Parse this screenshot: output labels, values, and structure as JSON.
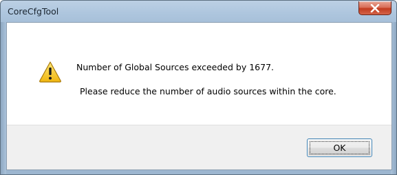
{
  "window": {
    "title": "CoreCfgTool",
    "frame_color": "#a9c1da"
  },
  "message": {
    "line1": "Number of Global Sources exceeded by 1677.",
    "line2": "Please reduce the number of audio sources within the core.",
    "icon": "warning-icon",
    "icon_color": "#f5c418"
  },
  "buttons": {
    "ok_label": "OK",
    "close_icon": "close-icon",
    "close_color": "#c7452a"
  }
}
